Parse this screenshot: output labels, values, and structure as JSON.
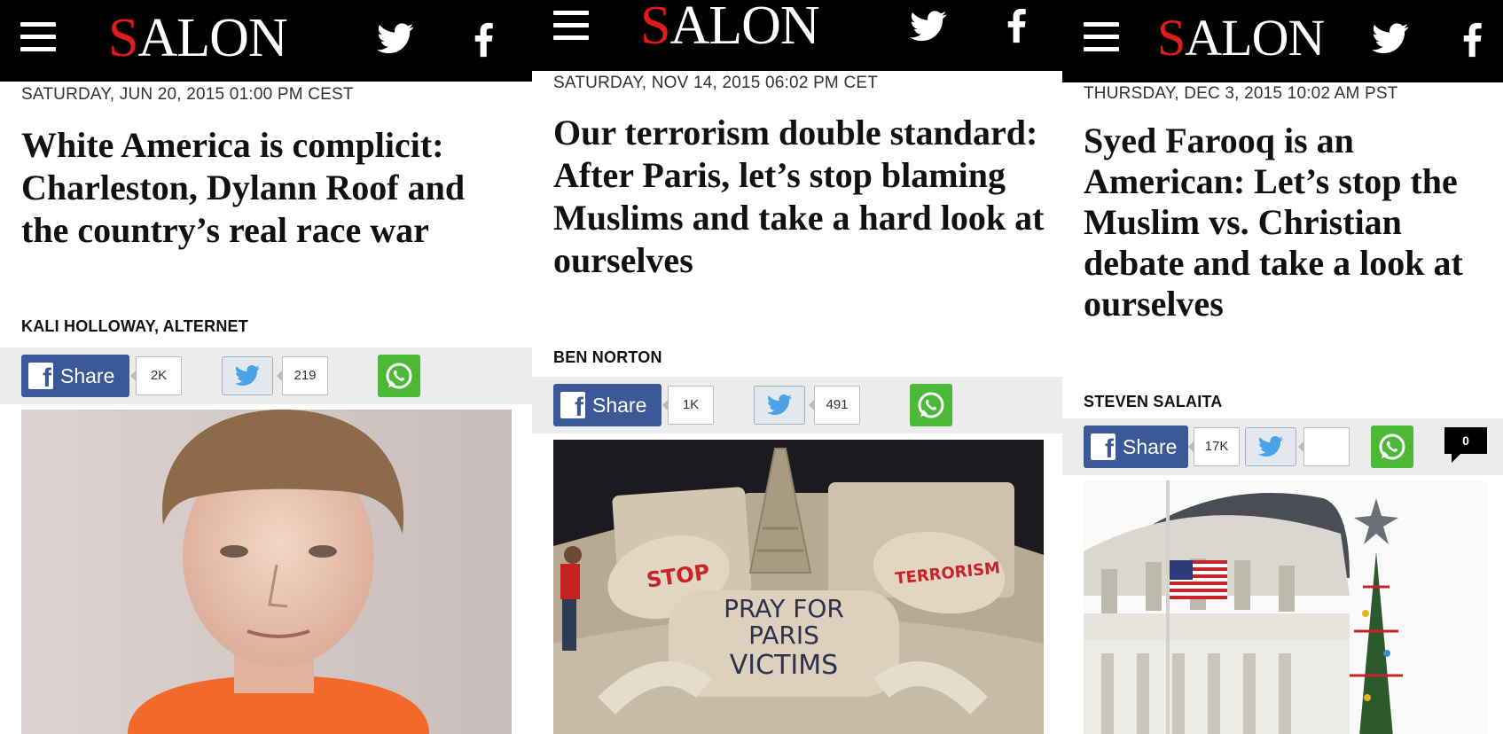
{
  "colors": {
    "brand_red": "#e41b1b",
    "topbar": "#000000",
    "facebook": "#3b5998",
    "twitter": "#4aa3e8",
    "whatsapp": "#4cb837"
  },
  "icons": [
    "menu-icon",
    "twitter-icon",
    "facebook-icon",
    "whatsapp-icon",
    "comment-icon"
  ],
  "panels": [
    {
      "logo_first": "S",
      "logo_rest": "ALON",
      "date": "SATURDAY, JUN 20, 2015 01:00 PM CEST",
      "headline": "White America is complicit: Charleston, Dylann Roof and the country’s real race war",
      "byline": "KALI HOLLOWAY, ALTERNET",
      "share_label": "Share",
      "fb_count": "2K",
      "tw_count": "219",
      "image_alt": "Mugshot of a young man with a bowl haircut in an orange shirt"
    },
    {
      "logo_first": "S",
      "logo_rest": "ALON",
      "date": "SATURDAY, NOV 14, 2015 06:02 PM CET",
      "headline": "Our terrorism double standard: After Paris, let’s stop blaming Muslims and take a hard look at ourselves",
      "byline": "BEN NORTON",
      "share_label": "Share",
      "fb_count": "1K",
      "tw_count": "491",
      "image_text": {
        "left_hand": "STOP",
        "right_hand": "TERRORISM",
        "line1": "PRAY FOR",
        "line2": "PARIS",
        "line3": "VICTIMS"
      }
    },
    {
      "logo_first": "S",
      "logo_rest": "ALON",
      "date": "THURSDAY, DEC 3, 2015 10:02 AM PST",
      "headline": "Syed Farooq is an American: Let’s stop the Muslim vs. Christian debate and take a look at ourselves",
      "byline": "STEVEN SALAITA",
      "share_label": "Share",
      "fb_count": "17K",
      "tw_count": "",
      "comments": "0",
      "image_alt": "Capitol dome with a half-staff American flag and a Christmas tree"
    }
  ]
}
